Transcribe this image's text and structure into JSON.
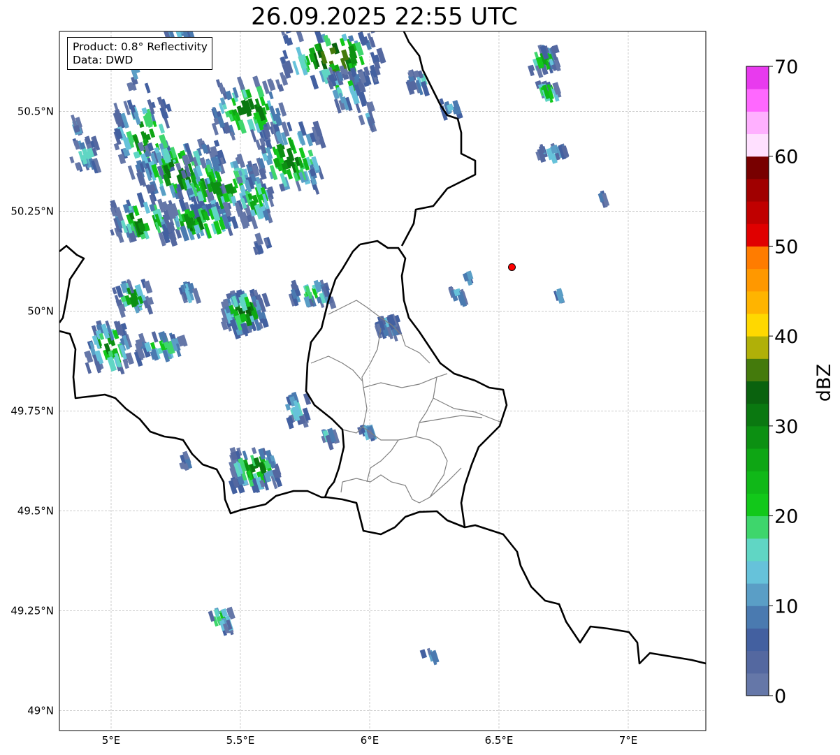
{
  "title": "26.09.2025 22:55 UTC",
  "info_box": {
    "line1": "Product: 0.8° Reflectivity",
    "line2": "Data: DWD"
  },
  "map": {
    "extent": {
      "lon": [
        4.8,
        7.3
      ],
      "lat": [
        48.95,
        50.7
      ]
    },
    "x_ticks": [
      "5°E",
      "5.5°E",
      "6°E",
      "6.5°E",
      "7°E"
    ],
    "y_ticks": [
      "50.5°N",
      "50.25°N",
      "50°N",
      "49.75°N",
      "49.5°N",
      "49.25°N",
      "49°N"
    ],
    "gridlines": true,
    "site_marker": {
      "lon": 6.55,
      "lat": 50.11,
      "color": "#ff0000"
    }
  },
  "colorbar": {
    "label": "dBZ",
    "min": 0,
    "max": 70,
    "step": 2.5,
    "tick_labels": [
      "0",
      "10",
      "20",
      "30",
      "40",
      "50",
      "60",
      "70"
    ],
    "colors": [
      "#6577a8",
      "#5468a0",
      "#4360a0",
      "#4a7ab0",
      "#5a9ec6",
      "#66c2da",
      "#60d6c4",
      "#3ed66c",
      "#12c81a",
      "#10b818",
      "#0ea614",
      "#0c9012",
      "#0a7810",
      "#0a620e",
      "#447a0c",
      "#b0b008",
      "#ffd800",
      "#ffb400",
      "#ff9800",
      "#ff7c00",
      "#e00000",
      "#c00000",
      "#a00000",
      "#780000",
      "#ffe0ff",
      "#ffb0ff",
      "#ff68ff",
      "#e83aee"
    ]
  }
}
